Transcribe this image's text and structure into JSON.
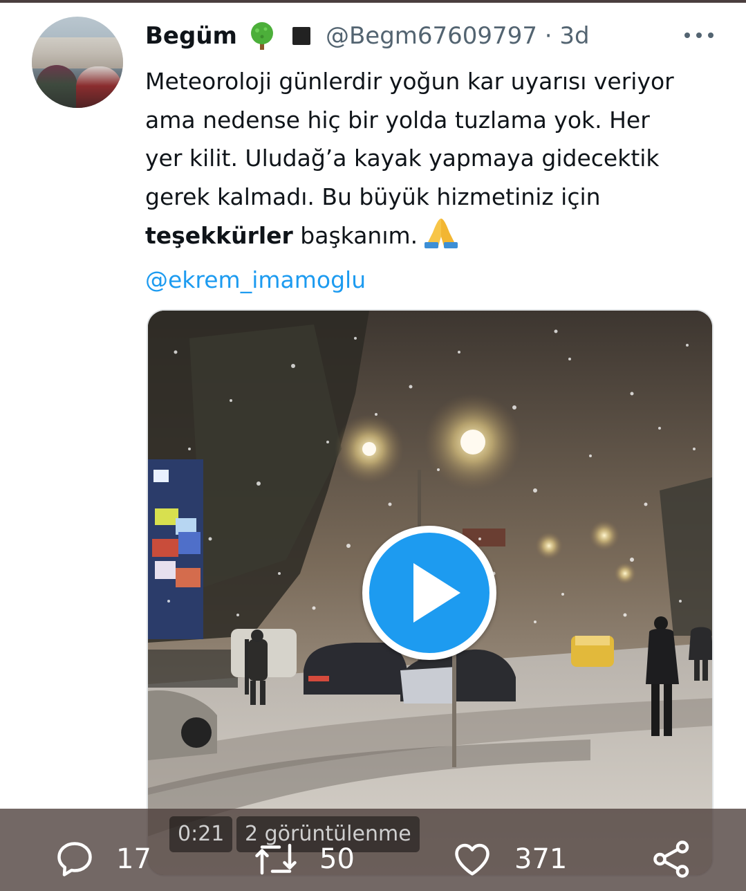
{
  "author": {
    "name": "Begüm",
    "handle": "@Begm67609797",
    "separator": "·",
    "time": "3d"
  },
  "tweet": {
    "lines": [
      "Meteoroloji günlerdir yoğun kar uyarısı veriyor",
      "ama nedense hiç bir yolda tuzlama yok. Her",
      "yer kilit. Uludağ’a kayak yapmaya gidecektik",
      "gerek kalmadı. Bu büyük hizmetiniz için"
    ],
    "bold_word": "teşekkürler",
    "after_bold": " başkanım.",
    "emoji": "🙏",
    "mention": "@ekrem_imamoglu"
  },
  "video": {
    "duration": "0:21",
    "views": "2 görüntülenme"
  },
  "actions": {
    "replies": "17",
    "retweets": "50",
    "likes": "371"
  },
  "icons": [
    "tree-icon",
    "square-icon",
    "more-icon",
    "pray-icon",
    "play-icon",
    "reply-icon",
    "retweet-icon",
    "like-icon",
    "share-icon"
  ],
  "colors": {
    "accent": "#1d9bf0",
    "text": "#0f1419",
    "secondary": "#536471"
  }
}
